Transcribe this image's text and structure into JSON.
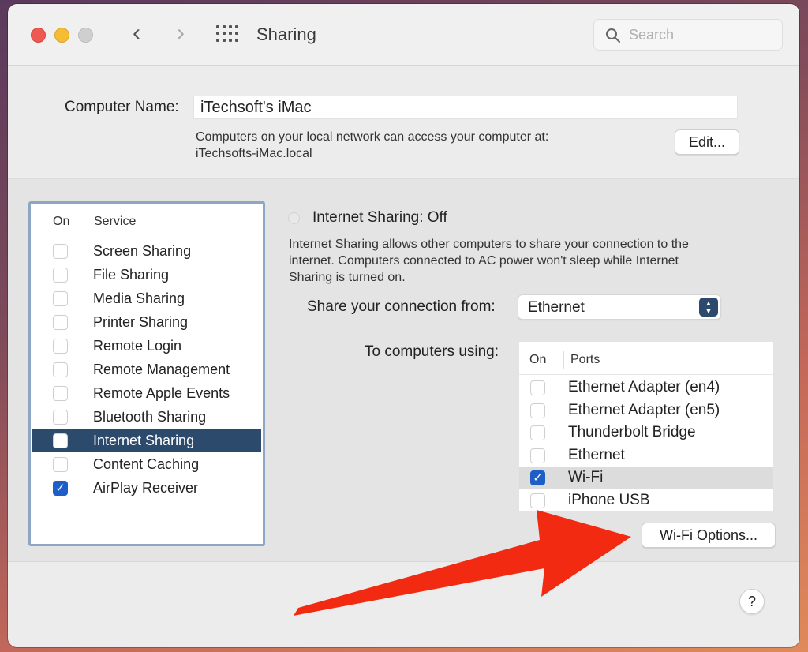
{
  "window": {
    "title": "Sharing",
    "search_placeholder": "Search"
  },
  "computer_name": {
    "label": "Computer Name:",
    "value": "iTechsoft's iMac",
    "desc_line1": "Computers on your local network can access your computer at:",
    "desc_line2": "iTechsofts-iMac.local",
    "edit_label": "Edit..."
  },
  "services": {
    "header_on": "On",
    "header_service": "Service",
    "items": [
      {
        "label": "Screen Sharing",
        "checked": false
      },
      {
        "label": "File Sharing",
        "checked": false
      },
      {
        "label": "Media Sharing",
        "checked": false
      },
      {
        "label": "Printer Sharing",
        "checked": false
      },
      {
        "label": "Remote Login",
        "checked": false
      },
      {
        "label": "Remote Management",
        "checked": false
      },
      {
        "label": "Remote Apple Events",
        "checked": false
      },
      {
        "label": "Bluetooth Sharing",
        "checked": false
      },
      {
        "label": "Internet Sharing",
        "checked": false,
        "selected": true
      },
      {
        "label": "Content Caching",
        "checked": false
      },
      {
        "label": "AirPlay Receiver",
        "checked": true
      }
    ]
  },
  "internet_sharing": {
    "title": "Internet Sharing: Off",
    "desc_line1": "Internet Sharing allows other computers to share your connection to the",
    "desc_line2": "internet. Computers connected to AC power won't sleep while Internet",
    "desc_line3": "Sharing is turned on.",
    "share_from_label": "Share your connection from:",
    "share_from_value": "Ethernet",
    "to_computers_label": "To computers using:",
    "ports_header_on": "On",
    "ports_header_ports": "Ports",
    "ports": [
      {
        "label": "Ethernet Adapter (en4)",
        "checked": false
      },
      {
        "label": "Ethernet Adapter (en5)",
        "checked": false
      },
      {
        "label": "Thunderbolt Bridge",
        "checked": false
      },
      {
        "label": "Ethernet",
        "checked": false
      },
      {
        "label": "Wi-Fi",
        "checked": true,
        "highlight": true
      },
      {
        "label": "iPhone USB",
        "checked": false
      }
    ],
    "wifi_options_label": "Wi-Fi Options..."
  },
  "help": {
    "label": "?"
  },
  "colors": {
    "selection": "#2c4a6c",
    "checkbox_checked": "#1d5ec8",
    "annotation_arrow": "#f22a12"
  }
}
